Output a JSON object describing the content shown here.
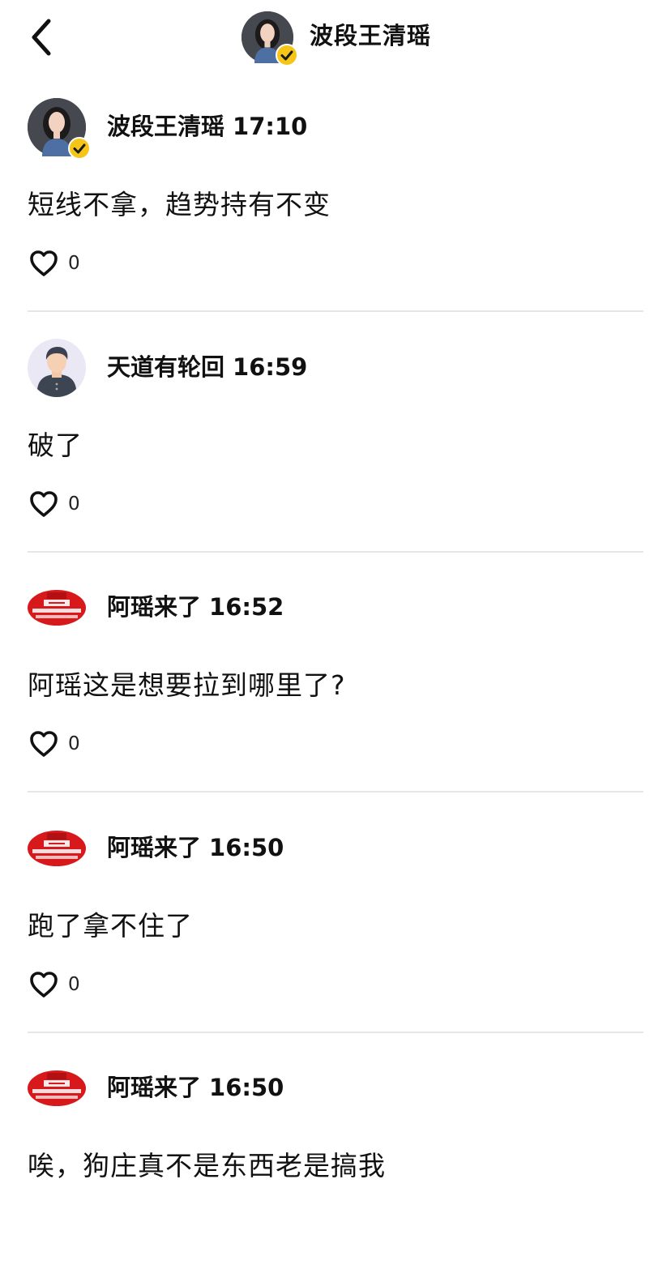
{
  "header": {
    "title": "波段王清瑶",
    "back_icon": "chevron-left-icon",
    "avatar_icon": "woman-portrait-avatar"
  },
  "colors": {
    "text": "#111111",
    "divider": "#e6e6e6",
    "verified_badge": "#f5c518",
    "banner_red": "#d7191c"
  },
  "comments": [
    {
      "author": "波段王清瑶",
      "time": "17:10",
      "text": "短线不拿，趋势持有不变",
      "likes": "0",
      "avatar": "woman-portrait-avatar",
      "verified": true
    },
    {
      "author": "天道有轮回",
      "time": "16:59",
      "text": "破了",
      "likes": "0",
      "avatar": "default-person-avatar",
      "verified": false
    },
    {
      "author": "阿瑶来了",
      "time": "16:52",
      "text": "阿瑶这是想要拉到哪里了?",
      "likes": "0",
      "avatar": "red-banner-avatar",
      "verified": false
    },
    {
      "author": "阿瑶来了",
      "time": "16:50",
      "text": "跑了拿不住了",
      "likes": "0",
      "avatar": "red-banner-avatar",
      "verified": false
    },
    {
      "author": "阿瑶来了",
      "time": "16:50",
      "text": "唉，狗庄真不是东西老是搞我",
      "likes": "",
      "avatar": "red-banner-avatar",
      "verified": false
    }
  ]
}
